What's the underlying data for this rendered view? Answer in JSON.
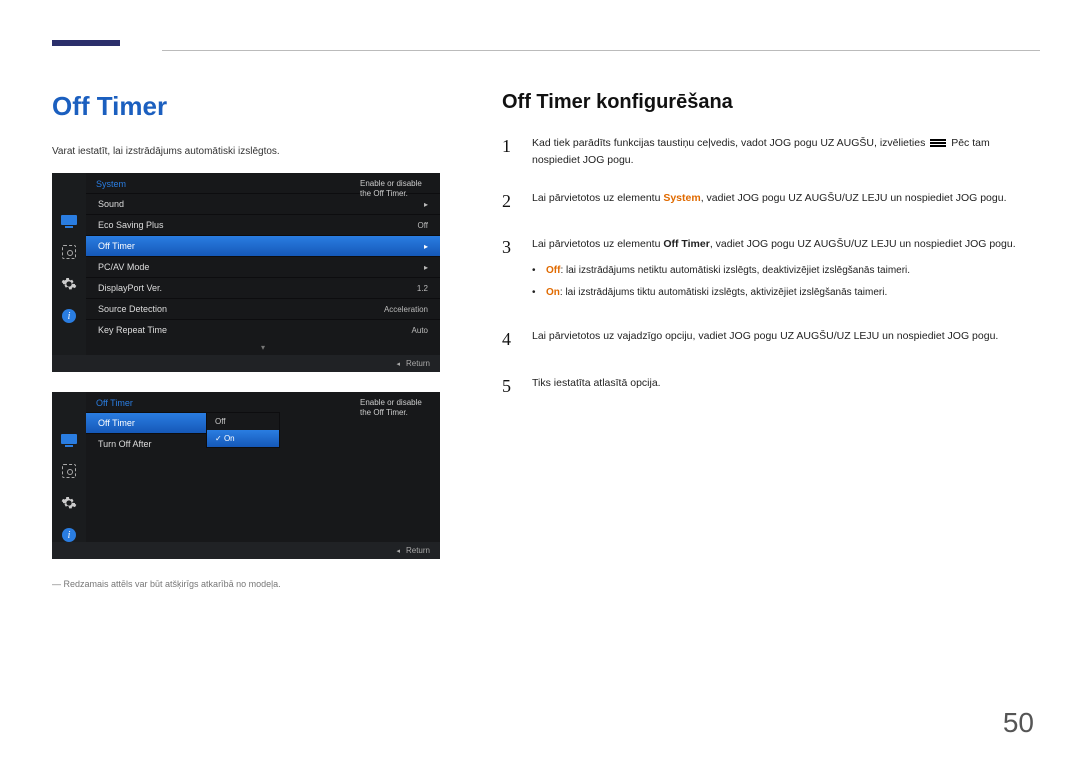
{
  "page_number": "50",
  "heading_main": "Off Timer",
  "intro_text": "Varat iestatīt, lai izstrādājums automātiski izslēgtos.",
  "footnote_text": "― Redzamais attēls var būt atšķirīgs atkarībā no modeļa.",
  "heading_sub": "Off Timer konfigurēšana",
  "osd1": {
    "title": "System",
    "desc1": "Enable or disable",
    "desc2": "the Off Timer.",
    "rows": [
      {
        "label": "Sound",
        "val": "",
        "arrow": "▸",
        "sel": false
      },
      {
        "label": "Eco Saving Plus",
        "val": "Off",
        "arrow": "",
        "sel": false
      },
      {
        "label": "Off Timer",
        "val": "",
        "arrow": "▸",
        "sel": true
      },
      {
        "label": "PC/AV Mode",
        "val": "",
        "arrow": "▸",
        "sel": false
      },
      {
        "label": "DisplayPort Ver.",
        "val": "1.2",
        "arrow": "",
        "sel": false
      },
      {
        "label": "Source Detection",
        "val": "Acceleration",
        "arrow": "",
        "sel": false
      },
      {
        "label": "Key Repeat Time",
        "val": "Auto",
        "arrow": "",
        "sel": false
      }
    ],
    "return_label": "Return",
    "return_arrow": "◂"
  },
  "osd2": {
    "title": "Off Timer",
    "desc1": "Enable or disable",
    "desc2": "the Off Timer.",
    "rows": [
      {
        "label": "Off Timer",
        "val": "",
        "arrow": "▸",
        "sel": true
      },
      {
        "label": "Turn Off After",
        "val": "",
        "arrow": "",
        "sel": false
      }
    ],
    "sub_off": "Off",
    "sub_on": "On",
    "return_label": "Return",
    "return_arrow": "◂"
  },
  "steps": {
    "s1_a": "Kad tiek parādīts funkcijas taustiņu ceļvedis, vadot JOG pogu UZ AUGŠU, izvēlieties ",
    "s1_b": " Pēc tam nospiediet JOG pogu.",
    "s2_a": "Lai pārvietotos uz elementu ",
    "s2_sys": "System",
    "s2_b": ", vadiet JOG pogu UZ AUGŠU/UZ LEJU un nospiediet JOG pogu.",
    "s3_a": "Lai pārvietotos uz elementu ",
    "s3_ot": "Off Timer",
    "s3_b": ", vadiet JOG pogu UZ AUGŠU/UZ LEJU un nospiediet JOG pogu.",
    "s3_off_k": "Off",
    "s3_off_v": ": lai izstrādājums netiktu automātiski izslēgts, deaktivizējiet izslēgšanās taimeri.",
    "s3_on_k": "On",
    "s3_on_v": ": lai izstrādājums tiktu automātiski izslēgts, aktivizējiet izslēgšanās taimeri.",
    "s4": "Lai pārvietotos uz vajadzīgo opciju, vadiet JOG pogu UZ AUGŠU/UZ LEJU un nospiediet JOG pogu.",
    "s5": "Tiks iestatīta atlasītā opcija.",
    "n1": "1",
    "n2": "2",
    "n3": "3",
    "n4": "4",
    "n5": "5"
  }
}
